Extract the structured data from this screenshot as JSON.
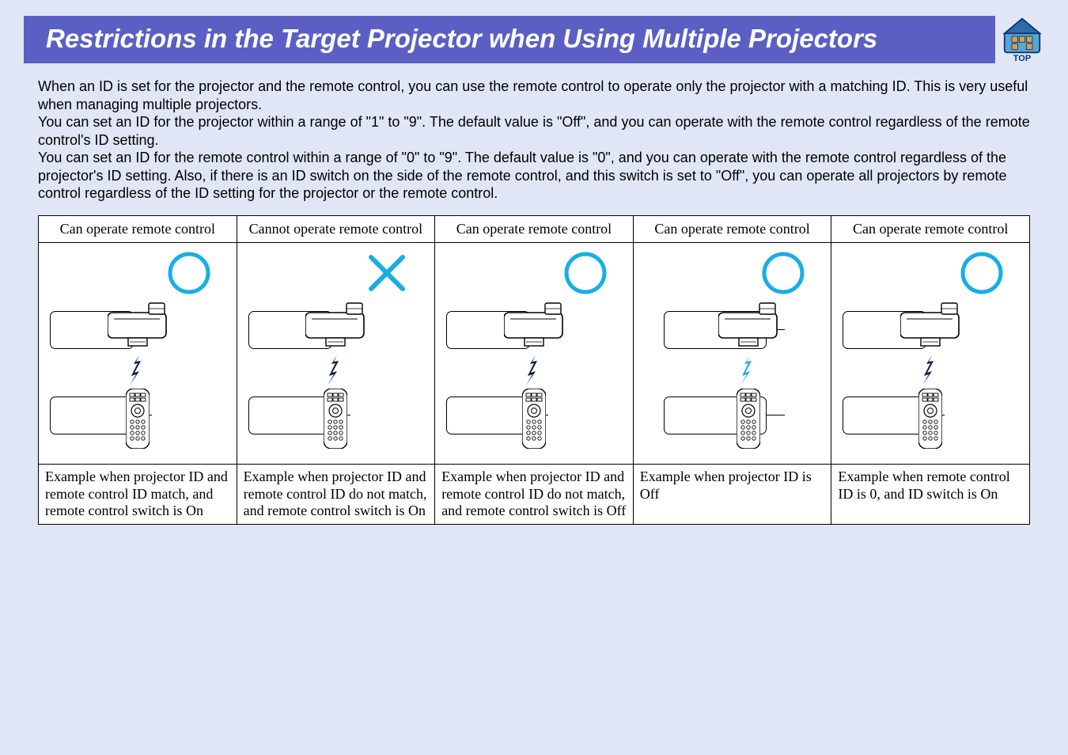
{
  "header": {
    "title": "Restrictions in the Target Projector when Using Multiple Projectors",
    "top_label": "TOP"
  },
  "intro": {
    "p1": "When an ID is set for the projector and the remote control, you can use the remote control to operate only the projector with a matching ID. This is very useful when managing multiple projectors.",
    "p2": "You can set an ID for the projector within a range of \"1\" to \"9\". The default value is \"Off\", and you can operate with the remote control regardless of the remote control's ID setting.",
    "p3": "You can set an ID for the remote control within a range of \"0\" to \"9\". The default value is \"0\", and you can operate with the remote control regardless of the projector's ID setting. Also, if there is an ID switch on the side of the remote control, and this switch is set to \"Off\", you can operate all projectors by remote control regardless of the ID setting for the projector or the remote control."
  },
  "table": {
    "headers": [
      "Can operate remote control",
      "Cannot operate remote control",
      "Can operate remote control",
      "Can operate remote control",
      "Can operate remote control"
    ],
    "captions": [
      "Example when projector ID and remote control ID match, and remote control switch is On",
      "Example when projector ID and remote control ID do not match, and remote control switch is On",
      "Example when projector ID and remote control ID do not match, and remote control switch is Off",
      "Example when projector ID is Off",
      "Example when remote control ID is 0, and ID switch is On"
    ],
    "marks": [
      "O",
      "X",
      "O",
      "O",
      "O"
    ],
    "arrows": [
      "light",
      "dark",
      "light",
      "light",
      "light"
    ]
  }
}
